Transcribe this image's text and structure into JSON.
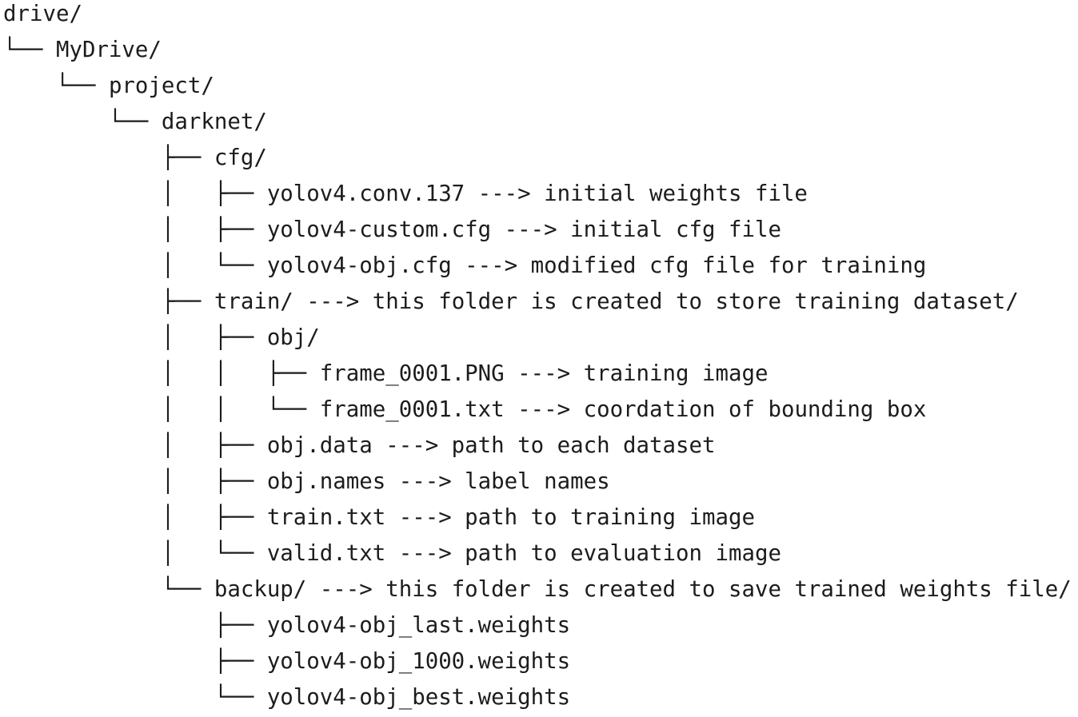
{
  "tree": {
    "lines": [
      {
        "prefix": "",
        "text": "drive/"
      },
      {
        "prefix": "└── ",
        "text": "MyDrive/"
      },
      {
        "prefix": "    └── ",
        "text": "project/"
      },
      {
        "prefix": "        └── ",
        "text": "darknet/"
      },
      {
        "prefix": "            ├── ",
        "text": "cfg/"
      },
      {
        "prefix": "            │   ├── ",
        "text": "yolov4.conv.137 ---> initial weights file"
      },
      {
        "prefix": "            │   ├── ",
        "text": "yolov4-custom.cfg ---> initial cfg file"
      },
      {
        "prefix": "            │   └── ",
        "text": "yolov4-obj.cfg ---> modified cfg file for training"
      },
      {
        "prefix": "            ├── ",
        "text": "train/ ---> this folder is created to store training dataset/"
      },
      {
        "prefix": "            │   ├── ",
        "text": "obj/"
      },
      {
        "prefix": "            │   │   ├── ",
        "text": "frame_0001.PNG ---> training image"
      },
      {
        "prefix": "            │   │   └── ",
        "text": "frame_0001.txt ---> coordation of bounding box"
      },
      {
        "prefix": "            │   ├── ",
        "text": "obj.data ---> path to each dataset"
      },
      {
        "prefix": "            │   ├── ",
        "text": "obj.names ---> label names"
      },
      {
        "prefix": "            │   ├── ",
        "text": "train.txt ---> path to training image"
      },
      {
        "prefix": "            │   └── ",
        "text": "valid.txt ---> path to evaluation image"
      },
      {
        "prefix": "            └── ",
        "text": "backup/ ---> this folder is created to save trained weights file/"
      },
      {
        "prefix": "                ├── ",
        "text": "yolov4-obj_last.weights"
      },
      {
        "prefix": "                ├── ",
        "text": "yolov4-obj_1000.weights"
      },
      {
        "prefix": "                └── ",
        "text": "yolov4-obj_best.weights"
      }
    ]
  }
}
